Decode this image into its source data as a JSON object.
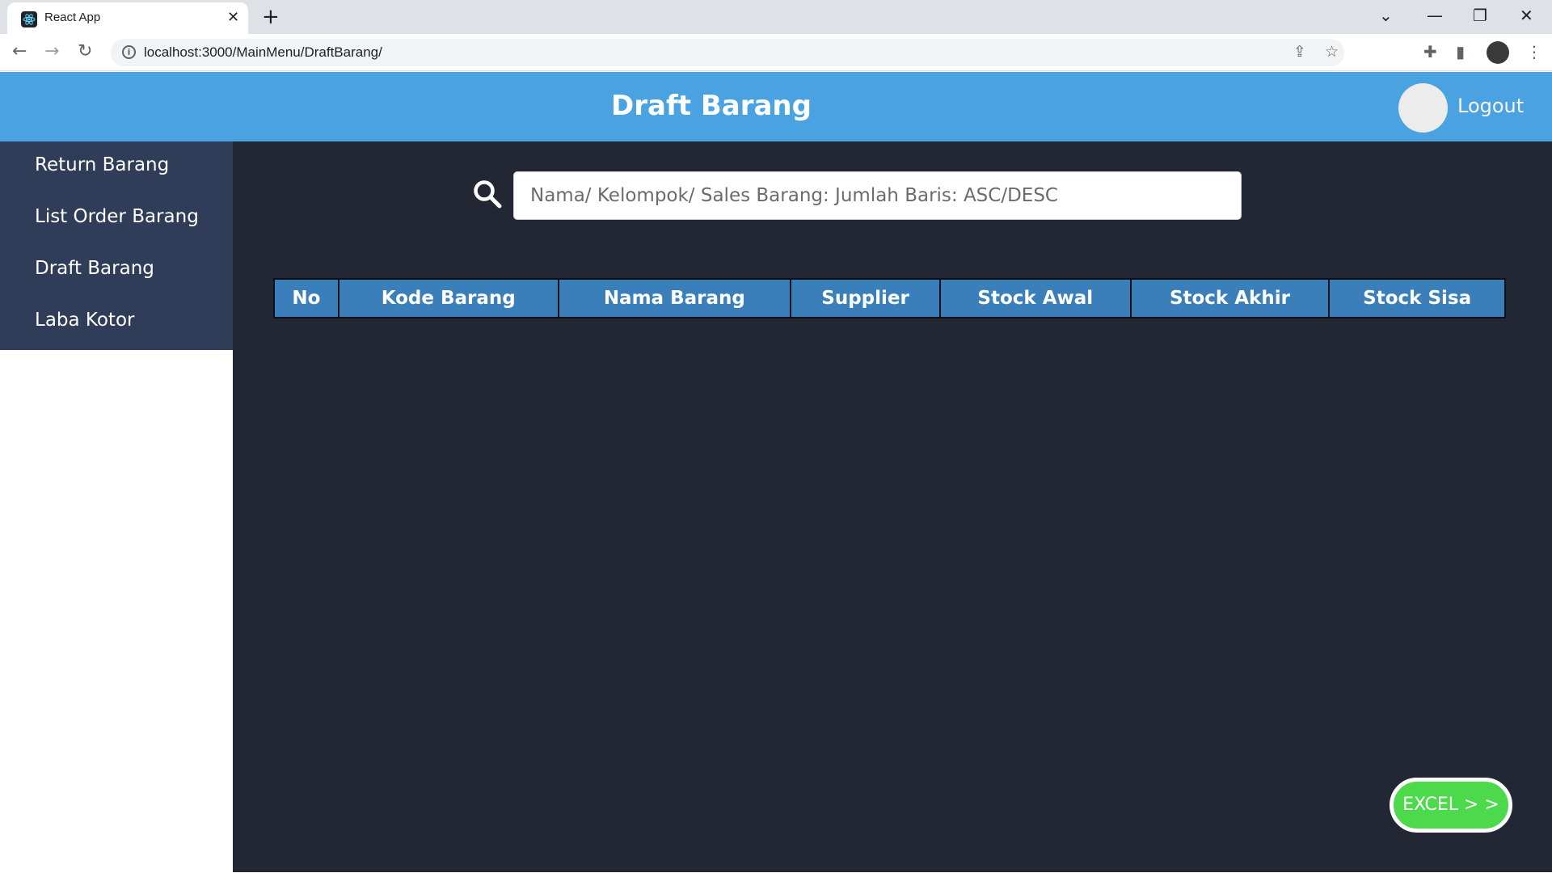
{
  "browser": {
    "tab_title": "React App",
    "tab_close": "✕",
    "new_tab": "+",
    "url": "localhost:3000/MainMenu/DraftBarang/",
    "window_controls": {
      "dropdown": "⌄",
      "minimize": "—",
      "restore": "❐",
      "close": "✕"
    },
    "icons": [
      "back-arrow-icon",
      "forward-arrow-icon",
      "reload-icon",
      "site-info-icon",
      "share-icon",
      "star-icon",
      "extensions-icon",
      "side-panel-icon",
      "profile-avatar",
      "menu-icon"
    ]
  },
  "header": {
    "title": "Draft Barang",
    "logout_label": "Logout",
    "bg_color": "#4aa3e0"
  },
  "sidebar": {
    "items": [
      {
        "label": "Return Barang"
      },
      {
        "label": "List Order Barang"
      },
      {
        "label": "Draft Barang"
      },
      {
        "label": "Laba Kotor"
      }
    ],
    "bg_color": "#303d58"
  },
  "search": {
    "placeholder": "Nama/ Kelompok/ Sales Barang: Jumlah Baris: ASC/DESC",
    "icon": "search-icon"
  },
  "table": {
    "columns": [
      "No",
      "Kode Barang",
      "Nama Barang",
      "Supplier",
      "Stock Awal",
      "Stock Akhir",
      "Stock Sisa"
    ],
    "rows": []
  },
  "actions": {
    "excel_label": "EXCEL > >",
    "excel_color": "#4cd94c"
  }
}
